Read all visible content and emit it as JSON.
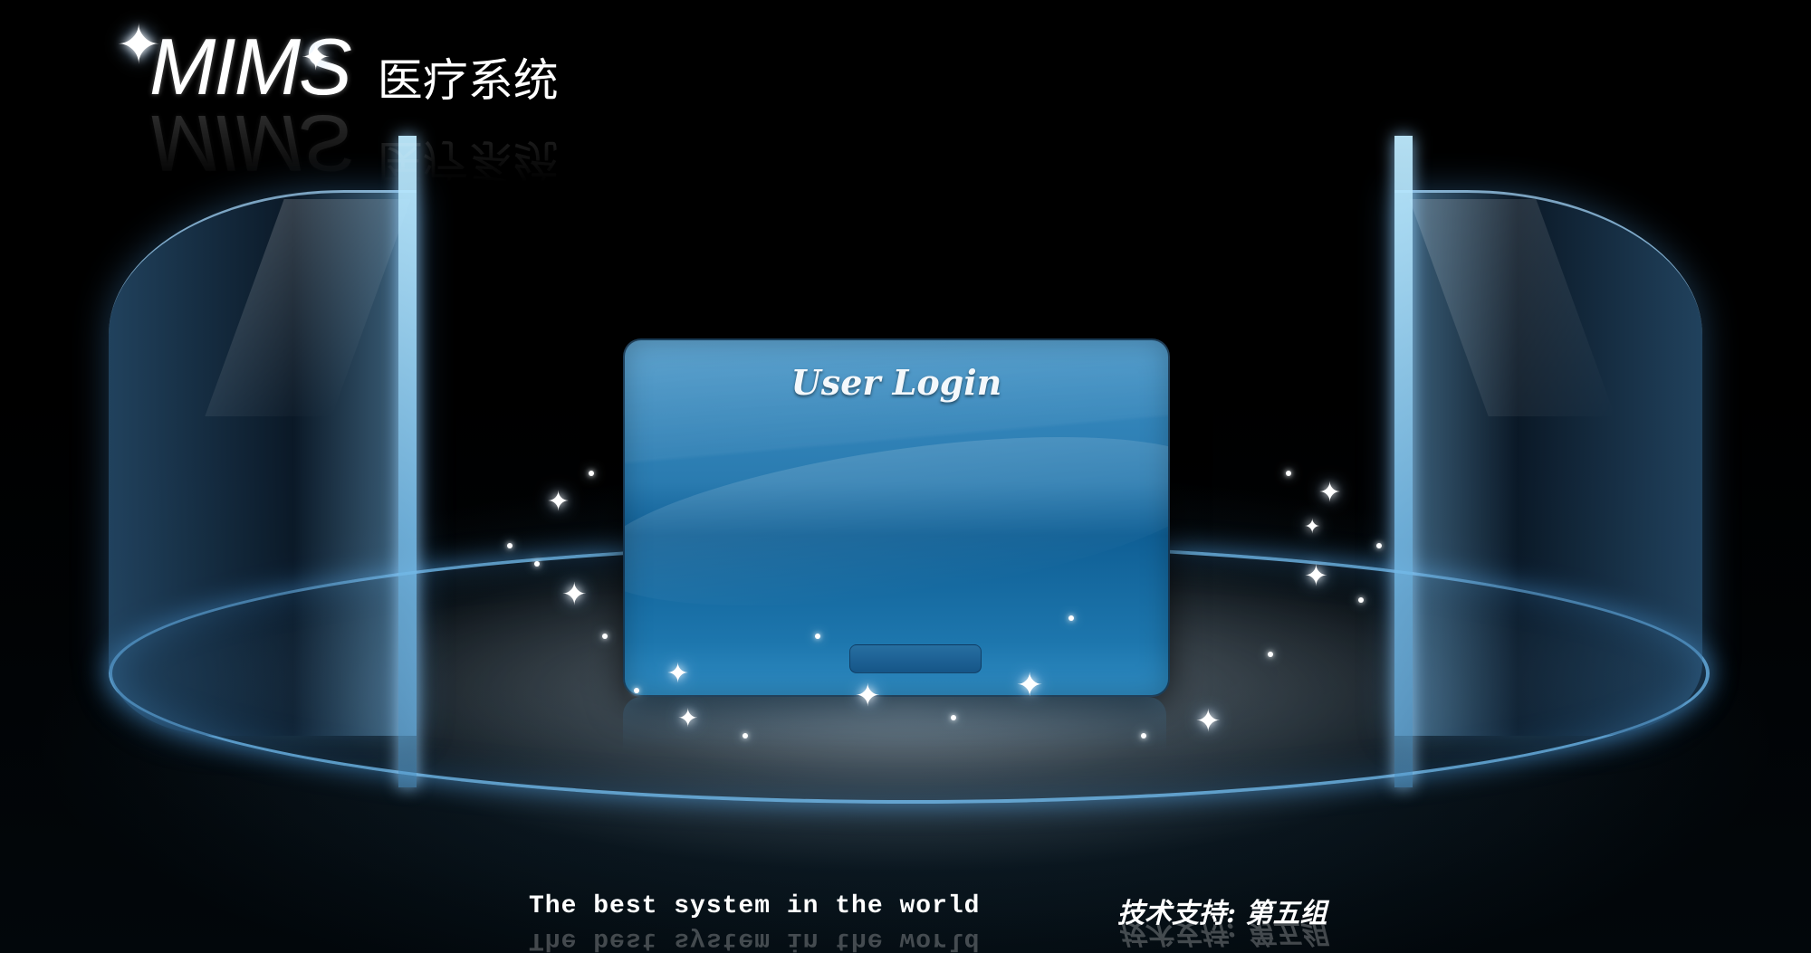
{
  "logo": {
    "name": "MIMS",
    "subtitle": "医疗系统"
  },
  "login": {
    "title": "User Login"
  },
  "footer": {
    "slogan": "The best system in the world",
    "support": "技术支持: 第五组"
  },
  "colors": {
    "background": "#000000",
    "card_blue": "#2a7bb0",
    "glass_cyan": "#78c8ff",
    "text": "#ffffff"
  }
}
